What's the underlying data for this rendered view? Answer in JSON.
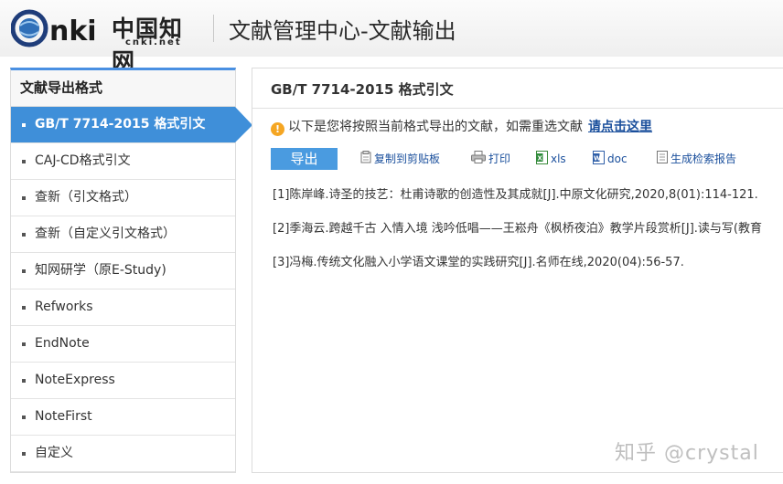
{
  "header": {
    "logo_mark": "CNKI",
    "logo_cn": "中国知网",
    "logo_sub": "cnki.net",
    "title": "文献管理中心-文献输出"
  },
  "sidebar": {
    "title": "文献导出格式",
    "items": [
      {
        "label": "GB/T 7714-2015 格式引文",
        "active": true
      },
      {
        "label": "CAJ-CD格式引文",
        "active": false
      },
      {
        "label": "查新（引文格式）",
        "active": false
      },
      {
        "label": "查新（自定义引文格式）",
        "active": false
      },
      {
        "label": "知网研学（原E-Study)",
        "active": false
      },
      {
        "label": "Refworks",
        "active": false
      },
      {
        "label": "EndNote",
        "active": false
      },
      {
        "label": "NoteExpress",
        "active": false
      },
      {
        "label": "NoteFirst",
        "active": false
      },
      {
        "label": "自定义",
        "active": false
      }
    ]
  },
  "main": {
    "title": "GB/T 7714-2015 格式引文",
    "notice_text": "以下是您将按照当前格式导出的文献，如需重选文献",
    "notice_link": "请点击这里",
    "toolbar": {
      "export": "导出",
      "copy": "复制到剪贴板",
      "print": "打印",
      "xls": "xls",
      "doc": "doc",
      "report": "生成检索报告"
    },
    "references": [
      "[1]陈岸峰.诗圣的技艺：杜甫诗歌的创造性及其成就[J].中原文化研究,2020,8(01):114-121.",
      "[2]季海云.跨越千古 入情入境 浅吟低唱——王崧舟《枫桥夜泊》教学片段赏析[J].读与写(教育",
      "[3]冯梅.传统文化融入小学语文课堂的实践研究[J].名师在线,2020(04):56-57."
    ]
  },
  "watermark": "知乎 @crystal",
  "colors": {
    "accent": "#3f8fd9",
    "export_button": "#4a9be0",
    "link": "#1a4f9c",
    "warning": "#f5a623"
  }
}
